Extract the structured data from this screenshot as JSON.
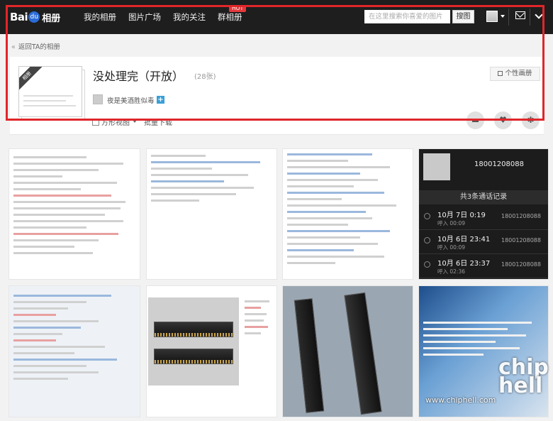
{
  "topbar": {
    "logo_text": "Bai",
    "logo_paw": "du",
    "logo_suffix": "相册",
    "nav": [
      "我的相册",
      "图片广场",
      "我的关注",
      "群相册"
    ],
    "hot_badge": "HOT",
    "search_placeholder": "在这里搜索你喜爱的图片",
    "search_button": "搜图"
  },
  "back_link": "返回TA的相册",
  "album": {
    "cover_ribbon": "相册",
    "title": "没处理完（开放）",
    "count": "(28张)",
    "owner": "夜是美酒胜似毒",
    "plus": "+",
    "personal_button": "个性画册"
  },
  "toolbar": {
    "view_label": "方形视图",
    "download_label": "批量下载"
  },
  "phone_shot": {
    "number": "18001208088",
    "header": "共3条通话记录",
    "calls": [
      {
        "time": "10月 7日 0:19",
        "sub": "呼入 00:09",
        "num": "18001208088"
      },
      {
        "time": "10月 6日 23:41",
        "sub": "呼入 00:09",
        "num": "18001208088"
      },
      {
        "time": "10月 6日 23:37",
        "sub": "呼入 02:36",
        "num": "18001208088"
      }
    ]
  },
  "watermark": "www.chiphell.com",
  "brand_mark": "chip\nhell",
  "colors": {
    "topbar": "#1e1e1e",
    "highlight": "#e0262a",
    "accent_blue": "#3aa0d8",
    "hot": "#e4393c"
  }
}
